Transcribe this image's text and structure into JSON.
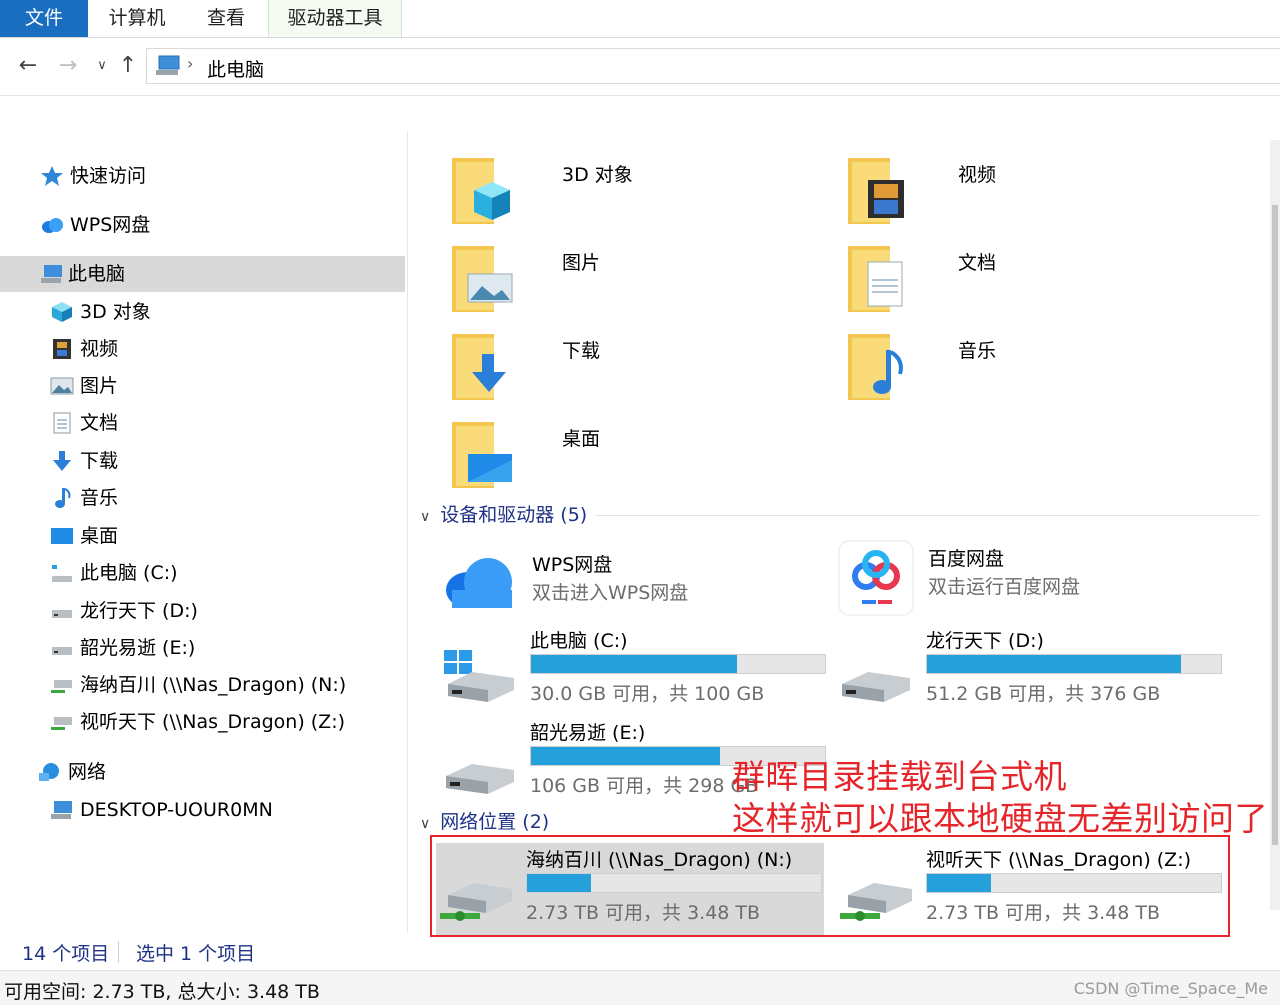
{
  "ribbon": {
    "tabs": [
      "文件",
      "计算机",
      "查看",
      "驱动器工具"
    ]
  },
  "address": {
    "path": "此电脑"
  },
  "nav_pane": {
    "quick_access": "快速访问",
    "wps_cloud": "WPS网盘",
    "this_pc": "此电脑",
    "children": [
      "3D 对象",
      "视频",
      "图片",
      "文档",
      "下载",
      "音乐",
      "桌面",
      "此电脑 (C:)",
      "龙行天下 (D:)",
      "韶光易逝 (E:)",
      "海纳百川 (\\\\Nas_Dragon) (N:)",
      "视听天下 (\\\\Nas_Dragon) (Z:)"
    ],
    "network": "网络",
    "network_child": "DESKTOP-UOUR0MN"
  },
  "content": {
    "folders": [
      "3D 对象",
      "视频",
      "图片",
      "文档",
      "下载",
      "音乐",
      "桌面"
    ],
    "devices_header": "设备和驱动器 (5)",
    "apps": [
      {
        "name": "WPS网盘",
        "sub": "双击进入WPS网盘"
      },
      {
        "name": "百度网盘",
        "sub": "双击运行百度网盘"
      }
    ],
    "drives": [
      {
        "name": "此电脑 (C:)",
        "used_fraction": 0.7,
        "sub": "30.0 GB 可用，共 100 GB"
      },
      {
        "name": "龙行天下 (D:)",
        "used_fraction": 0.864,
        "sub": "51.2 GB 可用，共 376 GB"
      },
      {
        "name": "韶光易逝 (E:)",
        "used_fraction": 0.644,
        "sub": "106 GB 可用，共 298 GB"
      }
    ],
    "network_header": "网络位置 (2)",
    "net_drives": [
      {
        "name": "海纳百川 (\\\\Nas_Dragon) (N:)",
        "used_fraction": 0.216,
        "sub": "2.73 TB 可用，共 3.48 TB"
      },
      {
        "name": "视听天下 (\\\\Nas_Dragon) (Z:)",
        "used_fraction": 0.216,
        "sub": "2.73 TB 可用，共 3.48 TB"
      }
    ]
  },
  "annotation": {
    "line1": "群晖目录挂载到台式机",
    "line2": "这样就可以跟本地硬盘无差别访问了"
  },
  "status": {
    "item_count": "14 个项目",
    "selected": "选中 1 个项目",
    "space": "可用空间: 2.73 TB, 总大小: 3.48 TB",
    "watermark": "CSDN @Time_Space_Me"
  },
  "colors": {
    "accent": "#1a6ec0",
    "bar_fill": "#26a0da",
    "annotation_red": "#e5252a",
    "header_blue": "#1e3287"
  }
}
